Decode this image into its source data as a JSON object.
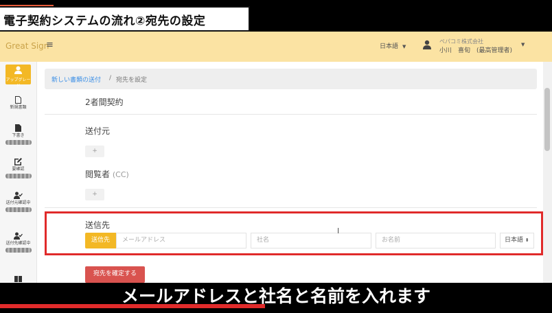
{
  "video_title": "電子契約システムの流れ②宛先の設定",
  "caption": "メールアドレスと社名と名前を入れます",
  "header": {
    "brand": "Great Sign",
    "menu_icon": "hamburger-icon",
    "language": "日本語",
    "org_name": "ペパコミ株式会社",
    "user_name": "小川　喜旬　(最高管理者)"
  },
  "sidebar": {
    "upgrade_label": "アップグレード",
    "items": [
      {
        "icon": "document-icon",
        "label": "新規書類"
      },
      {
        "icon": "document-filled-icon",
        "label": "下書き"
      },
      {
        "icon": "edit-icon",
        "label": "要確認"
      },
      {
        "icon": "user-check-icon",
        "label": "送付元確認中"
      },
      {
        "icon": "user-check-icon",
        "label": "送付先確認中"
      }
    ]
  },
  "breadcrumb": {
    "link": "新しい書類の送付",
    "separator": "/",
    "current": "宛先を設定"
  },
  "main": {
    "contract_type": "2者間契約",
    "sender_label": "送付元",
    "viewer_label": "閲覧者",
    "viewer_suffix": "(CC)",
    "add_symbol": "+",
    "recipient": {
      "label": "送信先",
      "tag": "送信先",
      "email_placeholder": "メールアドレス",
      "company_placeholder": "社名",
      "name_placeholder": "お名前",
      "language_select": "日本語"
    },
    "confirm_button": "宛先を確定する"
  },
  "colors": {
    "accent_yellow": "#f3b825",
    "header_bg": "#fbe3a3",
    "highlight_red": "#e02a2a",
    "link_blue": "#3a8ee6",
    "button_red": "#d9534f"
  },
  "video_progress": 0.48
}
